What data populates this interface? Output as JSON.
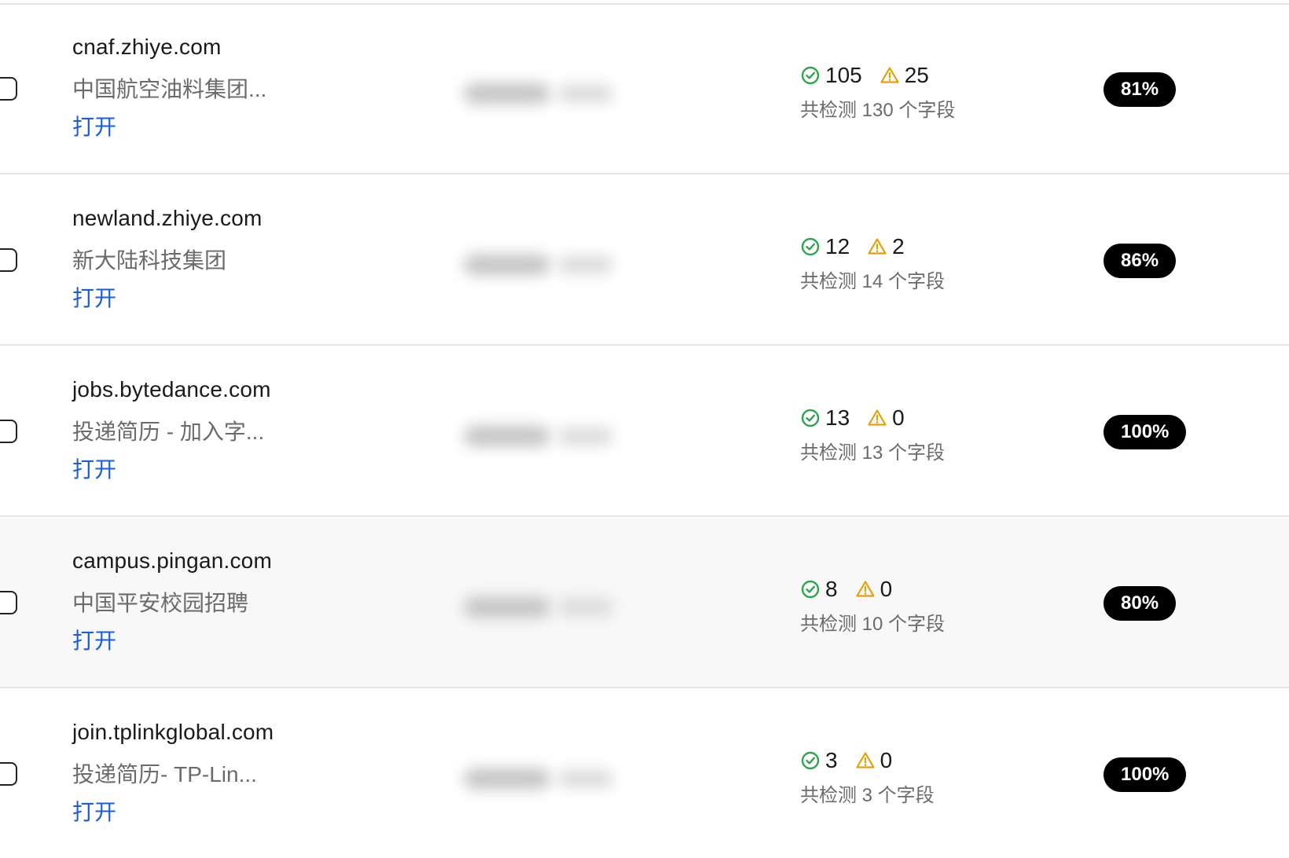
{
  "rows": [
    {
      "domain": "cnaf.zhiye.com",
      "subtitle": "中国航空油料集团...",
      "action": "打开",
      "passed": "105",
      "warnings": "25",
      "total": "共检测 130 个字段",
      "score": "81%"
    },
    {
      "domain": "newland.zhiye.com",
      "subtitle": "新大陆科技集团",
      "action": "打开",
      "passed": "12",
      "warnings": "2",
      "total": "共检测 14 个字段",
      "score": "86%"
    },
    {
      "domain": "jobs.bytedance.com",
      "subtitle": "投递简历 - 加入字...",
      "action": "打开",
      "passed": "13",
      "warnings": "0",
      "total": "共检测 13 个字段",
      "score": "100%"
    },
    {
      "domain": "campus.pingan.com",
      "subtitle": "中国平安校园招聘",
      "action": "打开",
      "passed": "8",
      "warnings": "0",
      "total": "共检测 10 个字段",
      "score": "80%"
    },
    {
      "domain": "join.tplinkglobal.com",
      "subtitle": "投递简历- TP-Lin...",
      "action": "打开",
      "passed": "3",
      "warnings": "0",
      "total": "共检测 3 个字段",
      "score": "100%"
    }
  ],
  "icons": {
    "passed": "check-circle-icon",
    "warning": "warning-triangle-icon"
  },
  "colors": {
    "link": "#1a5fd6",
    "check": "#2ea44f",
    "warning": "#e3a008",
    "badge_bg": "#000000",
    "badge_text": "#ffffff"
  }
}
